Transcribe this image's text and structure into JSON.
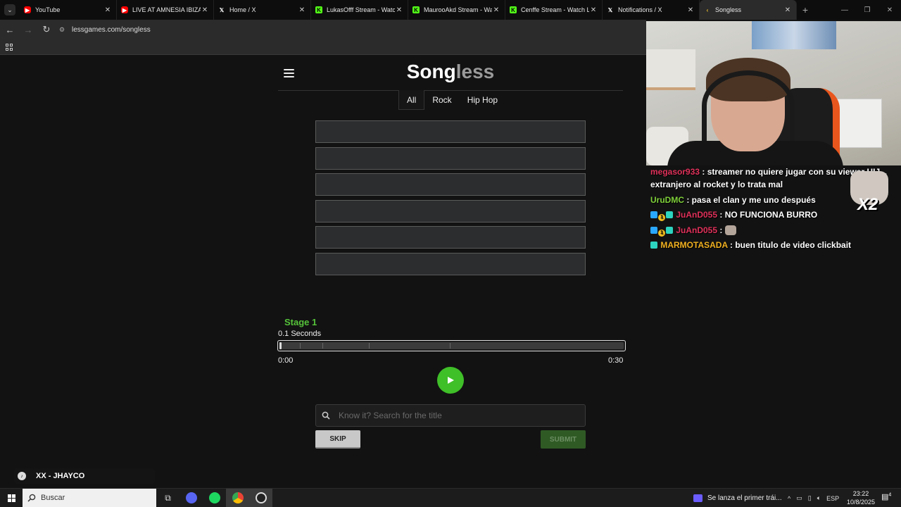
{
  "tabs": [
    {
      "title": "YouTube",
      "favicon": "youtube-icon"
    },
    {
      "title": "LIVE AT AMNESIA IBIZA | ...",
      "favicon": "youtube-icon"
    },
    {
      "title": "Home / X",
      "favicon": "x-icon"
    },
    {
      "title": "LukasOfff Stream - Watch Live on Kick",
      "favicon": "kick-icon"
    },
    {
      "title": "MaurooAkd Stream - Watch Live on Kick",
      "favicon": "kick-icon"
    },
    {
      "title": "Cenffe Stream - Watch Live on Kick",
      "favicon": "kick-icon"
    },
    {
      "title": "Notifications / X",
      "favicon": "x-icon"
    },
    {
      "title": "Songless",
      "favicon": "lessgames-icon"
    }
  ],
  "address_bar": {
    "url": "lessgames.com/songless"
  },
  "game": {
    "logo_part1": "Song",
    "logo_part2": "less",
    "genres": [
      "All",
      "Rock",
      "Hip Hop"
    ],
    "active_genre": "All",
    "guess_count": 6,
    "stage_label": "Stage 1",
    "seconds_label": "0.1 Seconds",
    "progress_fraction": 0.007,
    "time_start": "0:00",
    "time_end": "0:30",
    "search_placeholder": "Know it? Search for the title",
    "skip_label": "SKIP",
    "submit_label": "SUBMIT",
    "accent_color": "#3fbf28"
  },
  "now_playing": {
    "text": "XX - JHAYCO"
  },
  "chat": [
    {
      "user": "megasor933",
      "text": ": streamer no quiere jugar con su viewer HIJ... extranjero al rocket y lo trata mal",
      "color": "#e0315a"
    },
    {
      "user": "UruDMC",
      "text": ": pasa el clan y me uno después",
      "color": "#7fd13a"
    },
    {
      "user": "JuAnD055",
      "text": ": NO FUNCIONA BURRO",
      "color": "#e0315a"
    },
    {
      "user": "JuAnD055",
      "text": ":",
      "color": "#e0315a"
    },
    {
      "user": "MARMOTASADA",
      "text": ": buen titulo de video clickbait",
      "color": "#f0b020"
    }
  ],
  "emote_overlay": {
    "label": "X2"
  },
  "taskbar": {
    "search_label": "Buscar",
    "news_text": "Se lanza el primer trái...",
    "language": "ESP",
    "time": "23:22",
    "date": "10/8/2025",
    "notification_count": "4"
  }
}
